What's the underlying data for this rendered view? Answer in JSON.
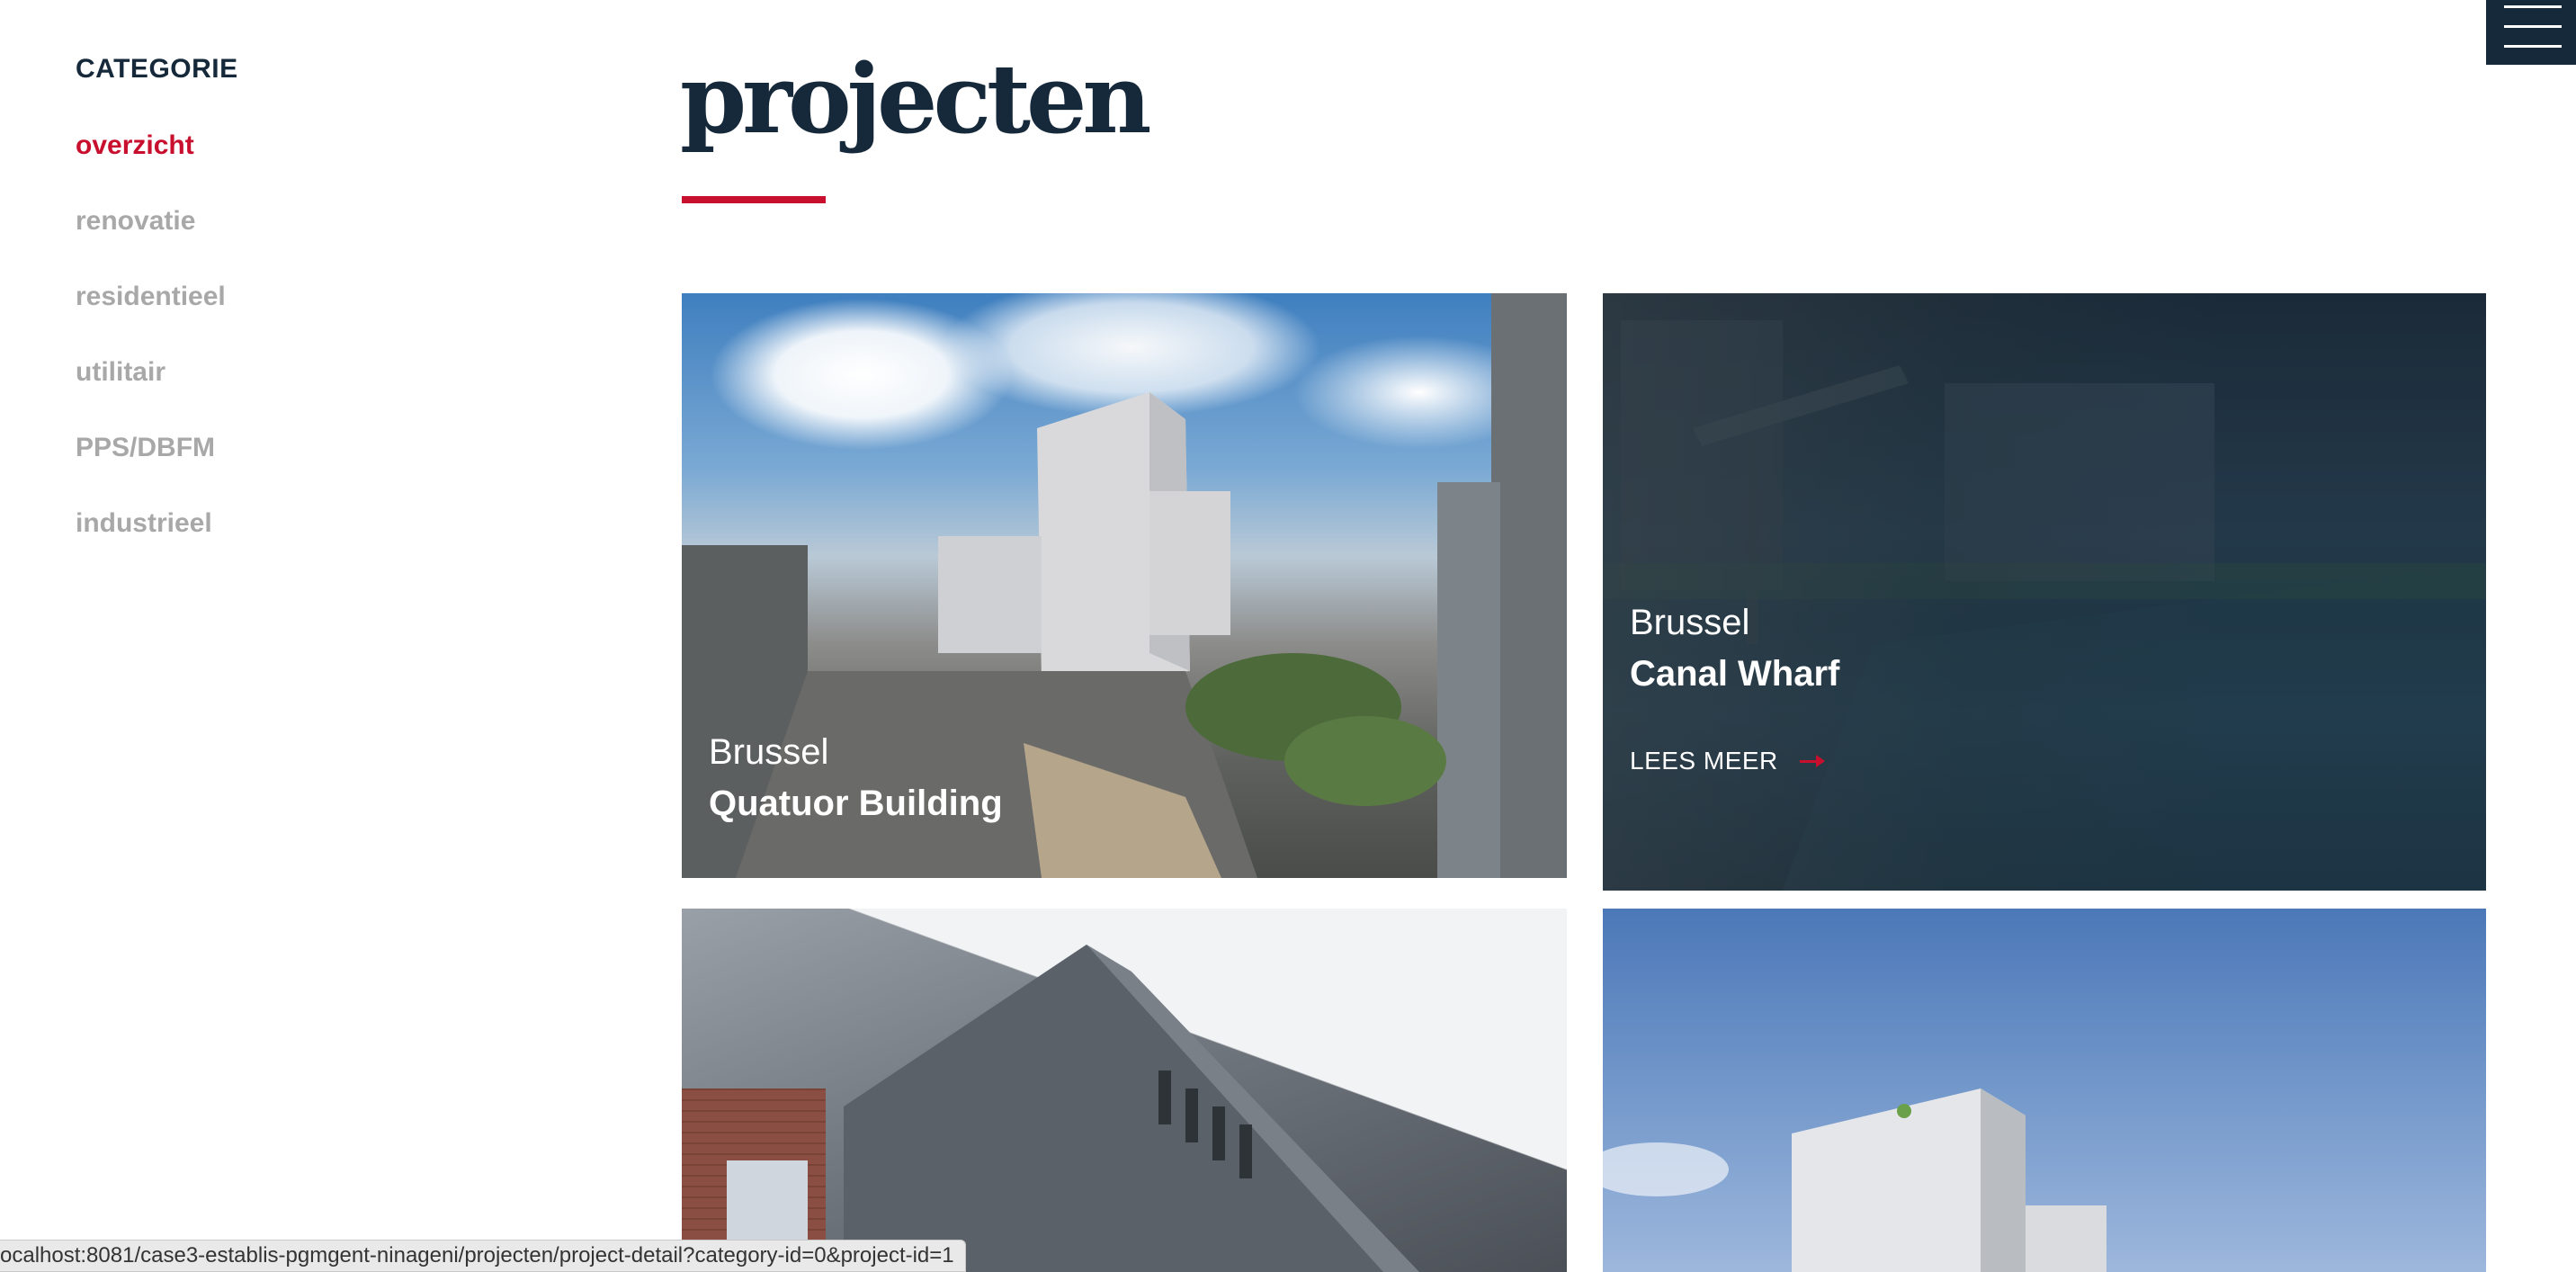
{
  "sidebar": {
    "heading": "CATEGORIE",
    "items": [
      {
        "label": "overzicht",
        "active": true
      },
      {
        "label": "renovatie",
        "active": false
      },
      {
        "label": "residentieel",
        "active": false
      },
      {
        "label": "utilitair",
        "active": false
      },
      {
        "label": "PPS/DBFM",
        "active": false
      },
      {
        "label": "industrieel",
        "active": false
      }
    ]
  },
  "header": {
    "title": "projecten"
  },
  "projects": [
    {
      "city": "Brussel",
      "name": "Quatuor Building",
      "hovered": false
    },
    {
      "city": "Brussel",
      "name": "Canal Wharf",
      "hovered": true,
      "read_more": "LEES MEER"
    },
    {
      "city": "",
      "name": "",
      "hovered": false
    },
    {
      "city": "",
      "name": "",
      "hovered": false
    }
  ],
  "menu": {
    "icon": "hamburger-icon"
  },
  "status_bar": {
    "url": "ocalhost:8081/case3-establis-pgmgent-ninageni/projecten/project-detail?category-id=0&project-id=1"
  },
  "colors": {
    "accent": "#c8102e",
    "navy": "#16293a",
    "inactive": "#a8a8a8"
  }
}
